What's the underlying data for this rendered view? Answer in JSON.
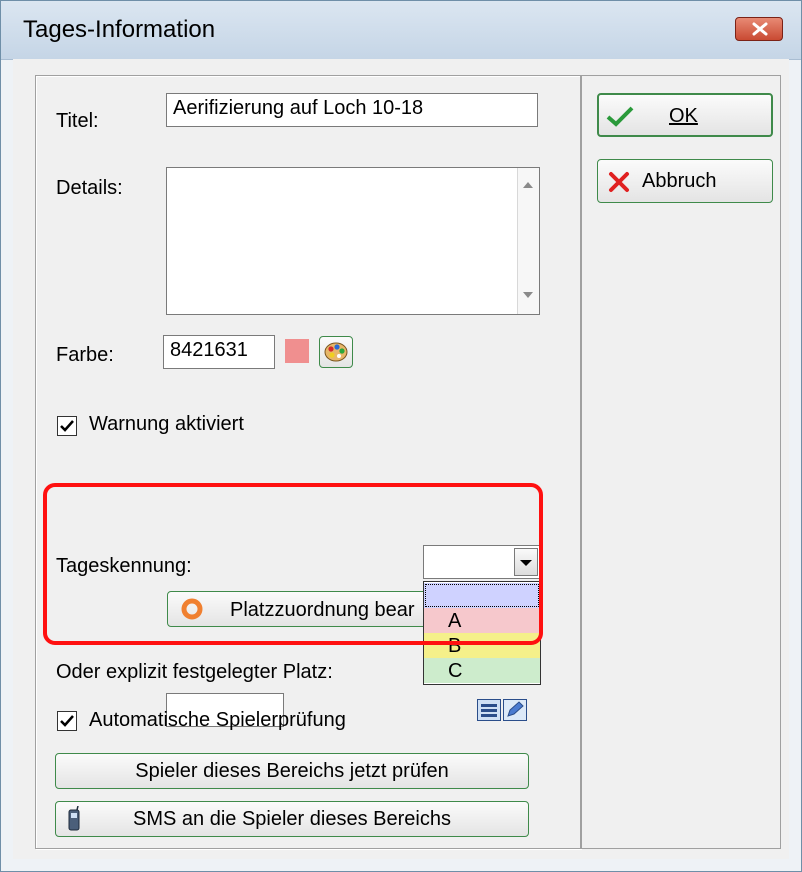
{
  "window": {
    "title": "Tages-Information"
  },
  "fields": {
    "titel_label": "Titel:",
    "titel_value": "Aerifizierung auf Loch 10-18",
    "details_label": "Details:",
    "details_value": "",
    "farbe_label": "Farbe:",
    "farbe_value": "8421631",
    "farbe_swatch": "#f08f8f"
  },
  "warnung": {
    "label": "Warnung aktiviert",
    "checked": true
  },
  "tageskennung": {
    "label": "Tageskennung:",
    "value": "",
    "options": [
      "",
      "A",
      "B",
      "C"
    ],
    "option_colors": [
      "#cfd2ff",
      "#f6c8cc",
      "#f5f08a",
      "#cdeccc"
    ]
  },
  "platz": {
    "button_label": "Platzzuordnung bear",
    "explicit_label": "Oder explizit festgelegter Platz:",
    "explicit_value": ""
  },
  "auto_check": {
    "label": "Automatische Spielerprüfung",
    "checked": true
  },
  "buttons": {
    "ok": "OK",
    "cancel": "Abbruch",
    "check_players": "Spieler dieses Bereichs jetzt prüfen",
    "sms": "SMS an die Spieler dieses Bereichs"
  },
  "icons": {
    "close": "close-icon",
    "ok": "checkmark-icon",
    "cancel": "x-icon",
    "color_picker": "palette-icon",
    "platz": "ring-icon",
    "phone": "phone-icon"
  }
}
